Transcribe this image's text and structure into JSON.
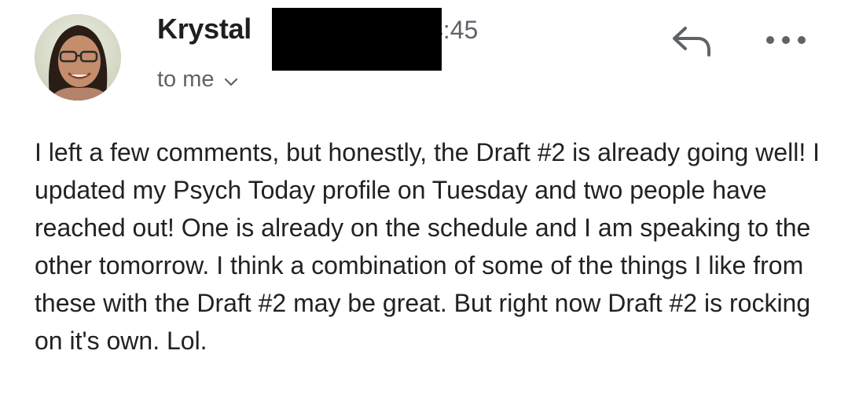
{
  "email": {
    "sender_name": "Krystal",
    "time": "4:45",
    "recipient": "to me",
    "body": "I left a few comments, but honestly, the Draft #2 is already going well! I updated my Psych Today profile on Tuesday and two people have reached out! One is already on the schedule and I am speaking to the other tomorrow. I think a combination of some of the things I like from these with the Draft #2 may be great. But right now Draft #2 is rocking on it's own. Lol."
  },
  "icons": {
    "avatar": "avatar-photo",
    "recipient_toggle": "chevron-down-icon",
    "reply": "reply-icon",
    "more": "more-horizontal-icon"
  },
  "colors": {
    "text": "#1f1f1f",
    "secondary": "#5f6368",
    "redaction": "#000000"
  }
}
